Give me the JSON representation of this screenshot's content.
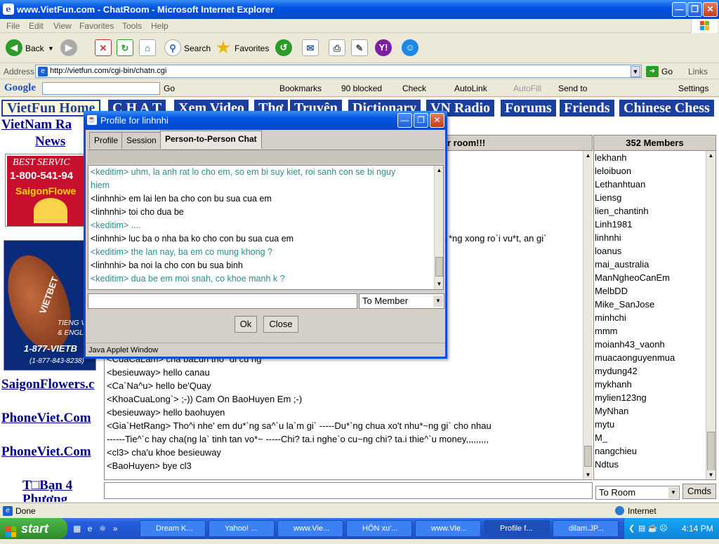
{
  "window": {
    "title": "www.VietFun.com - ChatRoom - Microsoft Internet Explorer"
  },
  "menu": [
    "File",
    "Edit",
    "View",
    "Favorites",
    "Tools",
    "Help"
  ],
  "toolbar": {
    "back": "Back",
    "search": "Search",
    "favorites": "Favorites"
  },
  "address": {
    "label": "Address",
    "url": "http://vietfun.com/cgi-bin/chatn.cgi",
    "go": "Go",
    "links": "Links"
  },
  "googlebar": {
    "logo": "Google",
    "go": "Go",
    "bookmarks": "Bookmarks",
    "blocked": "90 blocked",
    "check": "Check",
    "autolink": "AutoLink",
    "autofill": "AutoFill",
    "sendto": "Send to",
    "settings": "Settings"
  },
  "nav": [
    "VietFun Home",
    "C H A T",
    "Xem Video",
    "Thơ",
    "Truyện",
    "Dictionary",
    "VN Radio",
    "Forums",
    "Friends",
    "Chinese Chess"
  ],
  "left": {
    "vietnam": "VietNam Ra",
    "news": "News",
    "ad1_line1": "BEST SERVIC",
    "ad1_line2": "1-800-541-94",
    "ad1_line3": "SaigonFlowe",
    "ad2_brand": "VIETBET",
    "ad2_line1": "TIENG VI",
    "ad2_line2": "& ENGLIS",
    "ad2_line3": "1-877-VIETB",
    "ad2_line4": "(1-877-843-8238)",
    "links": [
      "SaigonFlowers.c",
      "PhoneViet.Com",
      "PhoneViet.Com",
      "T□Bạn 4",
      "Phương"
    ]
  },
  "chat": {
    "header": "r room!!!",
    "lines": [
      "*ng xong ro`i vu*t, an gi`",
      "<CuaCaLam> chă baLun tho` di cu ng",
      "<besieuway> hello canau",
      "<Ca`Na^u> hello be'Quay",
      "<KhoaCuaLong`> ;-))  Cam On  BaoHuyen  Em ;-)",
      "<besieuway> hello baohuyen",
      "<Gia`HetRang> Tho^i nhe'  em du*`ng  sa^`u  la`m  gi` -----Du*`ng  chua  xo't  nhu*~ng  gi`  cho  nhau",
      "   ------Tie^`c  hay  cha(ng  la`  tinh  tan  vo*~ -----Chi?  ta.i  nghe`o cu~ng  chi?  ta.i  thie^`u  money,,,,,,,,,",
      "<cl3> cha'u khoe besieuway",
      "<BaoHuyen> bye cl3"
    ]
  },
  "members": {
    "header": "352 Members",
    "list": [
      "lekhanh",
      "leloibuon",
      "Lethanhtuan",
      "Liensg",
      "lien_chantinh",
      "Linh1981",
      "linhnhi",
      "loanus",
      "mai_australia",
      "ManNgheoCanEm",
      "MelbDD",
      "Mike_SanJose",
      "minhchi",
      "mmm",
      "moianh43_vaonh",
      "muacaonguyenmua",
      "mydung42",
      "mykhanh",
      "mylien123ng",
      "MyNhan",
      "mytu",
      "M_",
      "nangchieu",
      "Ndtus"
    ]
  },
  "bottom": {
    "to_room": "To Room",
    "cmds": "Cmds"
  },
  "dialog": {
    "title": "Profile for linhnhi",
    "tabs": [
      "Profile",
      "Session",
      "Person-to-Person Chat"
    ],
    "lines": [
      {
        "who": "k",
        "text": "<keditim> uhm, la anh rat lo cho em, so em bi suy kiet, roi sanh con se bi nguy"
      },
      {
        "who": "k",
        "text": "   hiem"
      },
      {
        "who": "l",
        "text": "<linhnhi>  em lai len ba cho con bu sua cua em"
      },
      {
        "who": "l",
        "text": "<linhnhi>  toi cho dua be"
      },
      {
        "who": "k",
        "text": "<keditim> ...."
      },
      {
        "who": "l",
        "text": "<linhnhi>  luc ba o nha ba ko cho con bu sua cua em"
      },
      {
        "who": "k",
        "text": "<keditim> the lan nay, ba em co mung khong ?"
      },
      {
        "who": "l",
        "text": "<linhnhi>  ba noi la cho con bu sua binh"
      },
      {
        "who": "k",
        "text": "<keditim> dua be em moi snah, co khoe manh k ?"
      }
    ],
    "select": "To Member",
    "ok": "Ok",
    "close": "Close",
    "status": "Java Applet Window"
  },
  "statusbar": {
    "done": "Done",
    "zone": "Internet"
  },
  "taskbar": {
    "start": "start",
    "tasks": [
      "Dream K...",
      "Yahoo! ...",
      "www.Vie...",
      "HÔN xu'...",
      "www.Vie...",
      "Profile f...",
      "dilam.JP..."
    ],
    "time": "4:14 PM"
  }
}
